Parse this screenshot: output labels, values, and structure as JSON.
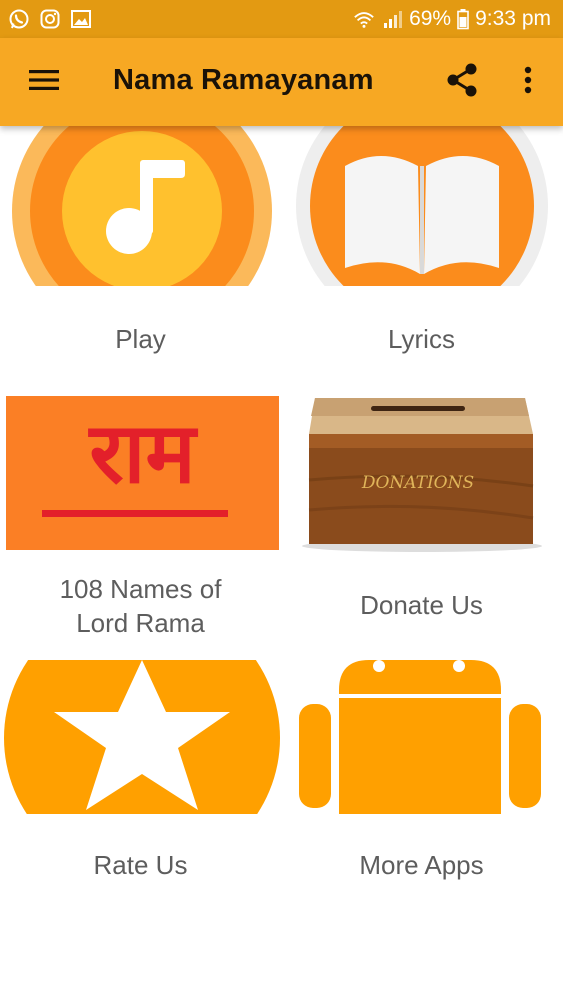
{
  "status_bar": {
    "notification_icons": [
      "whatsapp-icon",
      "instagram-icon",
      "gallery-icon"
    ],
    "system_icons": [
      "wifi-icon",
      "signal-icon"
    ],
    "battery": "69%",
    "time": "9:33 pm"
  },
  "app_bar": {
    "title": "Nama Ramayanam",
    "menu_icon": "hamburger-menu-icon",
    "share_icon": "share-icon",
    "overflow_icon": "more-vert-icon"
  },
  "grid": {
    "items": [
      {
        "label": "Play",
        "icon": "music-note-icon"
      },
      {
        "label": "Lyrics",
        "icon": "book-icon"
      },
      {
        "label": "108 Names of\nLord Rama",
        "line1": "108 Names of",
        "line2": "Lord Rama",
        "image_text": "राम",
        "icon": "rama-script-image"
      },
      {
        "label": "Donate Us",
        "image_text": "DONATIONS",
        "icon": "donation-box-image"
      },
      {
        "label": "Rate Us",
        "icon": "star-icon"
      },
      {
        "label": "More Apps",
        "icon": "android-icon"
      }
    ]
  },
  "colors": {
    "status_bar": "#e39a12",
    "app_bar": "#f7a823",
    "accent_orange": "#fb8c1c",
    "accent_yellow": "#ffa000",
    "rama_red": "#e3202a"
  }
}
